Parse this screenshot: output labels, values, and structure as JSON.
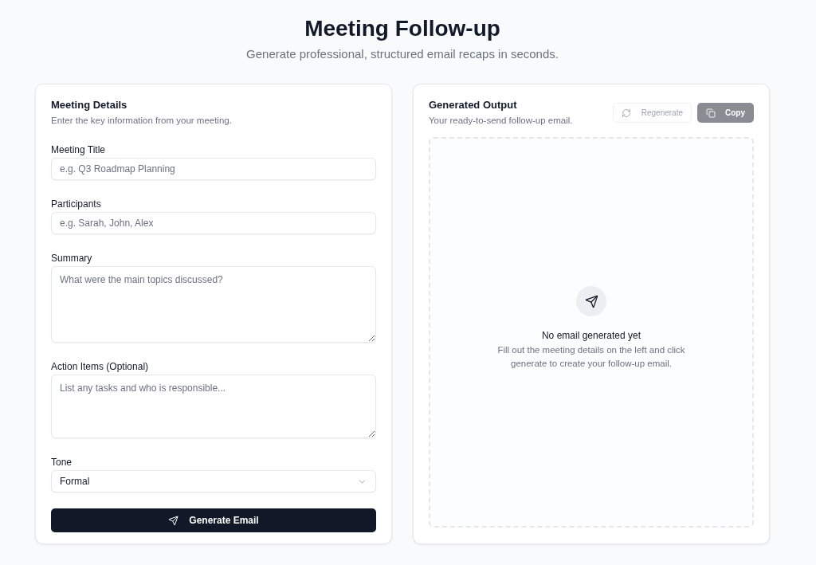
{
  "header": {
    "title": "Meeting Follow-up",
    "subtitle": "Generate professional, structured email recaps in seconds."
  },
  "form": {
    "title": "Meeting Details",
    "subtitle": "Enter the key information from your meeting.",
    "fields": [
      {
        "kind": "input",
        "label": "Meeting Title",
        "placeholder": "e.g. Q3 Roadmap Planning"
      },
      {
        "kind": "input",
        "label": "Participants",
        "placeholder": "e.g. Sarah, John, Alex"
      },
      {
        "kind": "textarea",
        "label": "Summary",
        "placeholder": "What were the main topics discussed?"
      },
      {
        "kind": "textarea",
        "label": "Action Items (Optional)",
        "placeholder": "List any tasks and who is responsible..."
      },
      {
        "kind": "select",
        "label": "Tone",
        "value": "Formal"
      }
    ],
    "submit": {
      "label": "Generate Email"
    }
  },
  "output": {
    "title": "Generated Output",
    "subtitle": "Your ready-to-send follow-up email.",
    "actions": [
      {
        "kind": "regenerate",
        "label": "Regenerate",
        "disabled": true
      },
      {
        "kind": "copy",
        "label": "Copy",
        "disabled": true
      }
    ],
    "empty_state": {
      "title": "No email generated yet",
      "message": "Fill out the meeting details on the left and click generate to create your follow-up email."
    }
  }
}
